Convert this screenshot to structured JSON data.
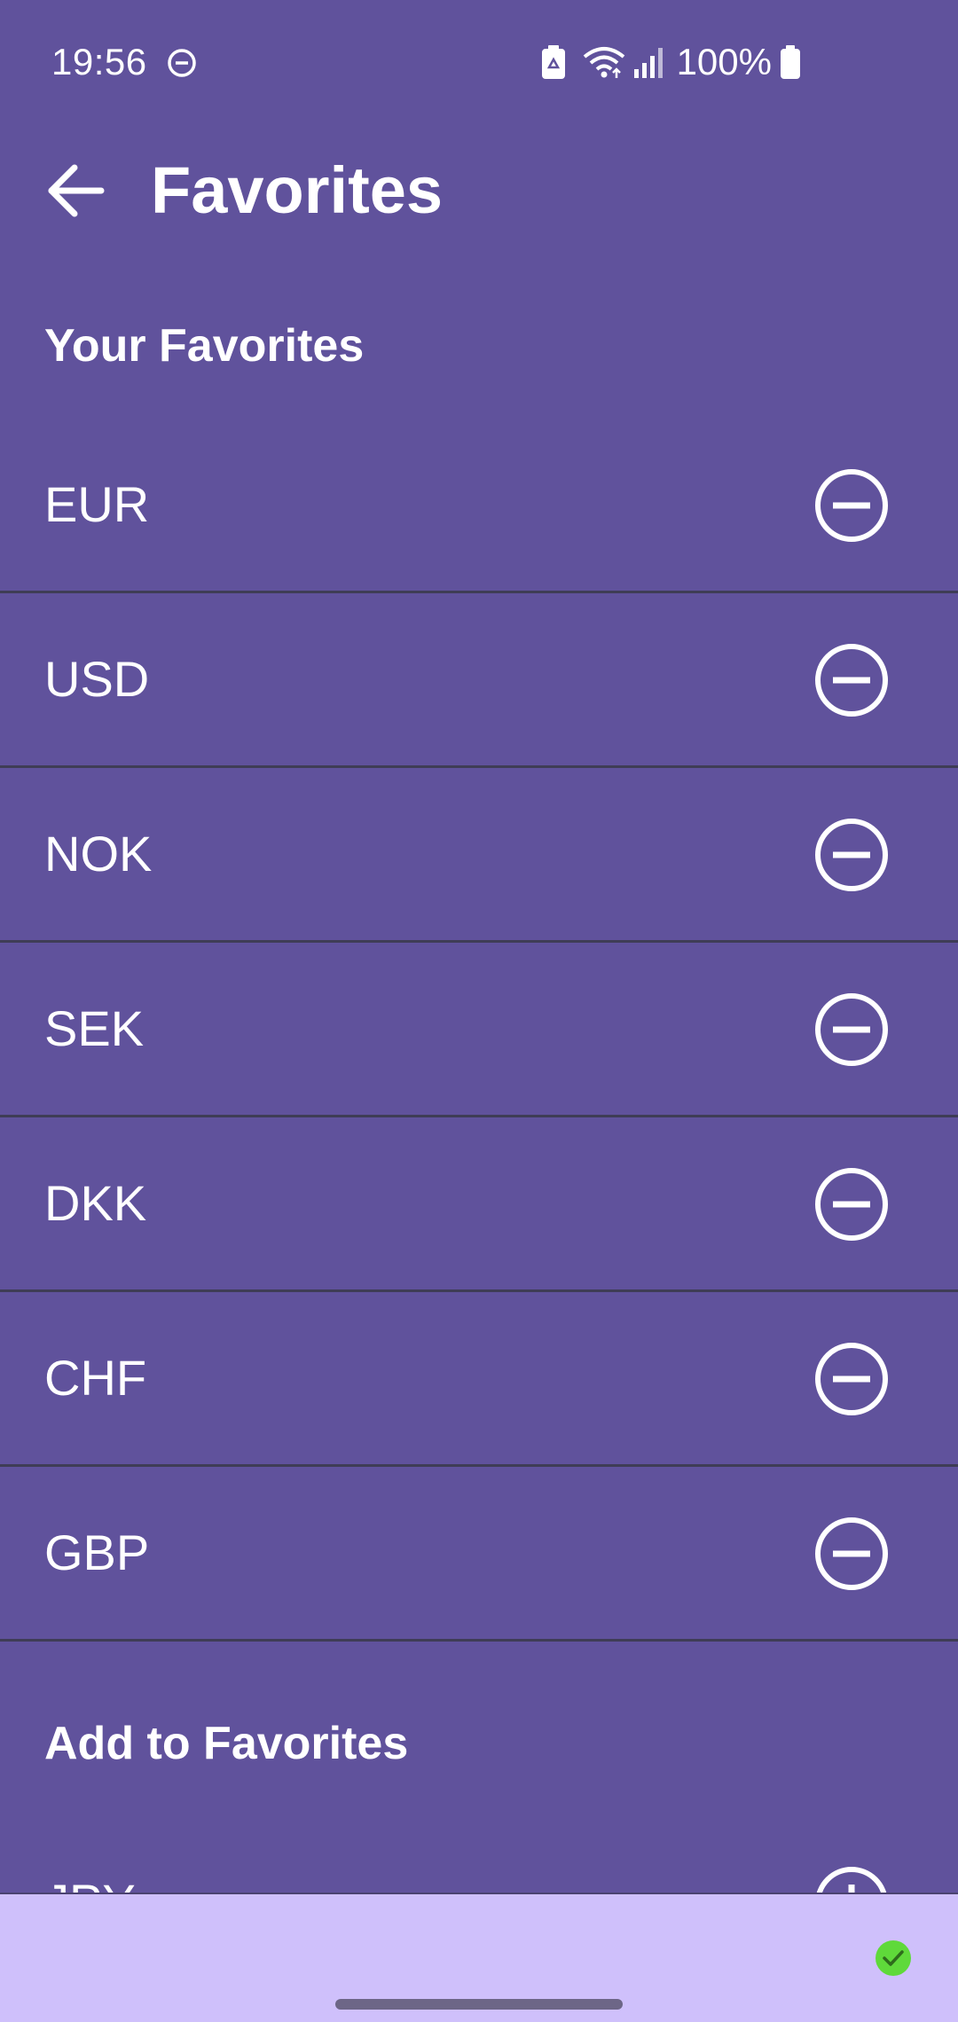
{
  "status_bar": {
    "time": "19:56",
    "battery": "100%",
    "icons": [
      "do-not-disturb-icon",
      "battery-saver-icon",
      "wifi-icon",
      "cellular-signal-icon",
      "battery-icon"
    ]
  },
  "app_bar": {
    "title": "Favorites",
    "back_icon": "arrow-left-icon"
  },
  "favorites": {
    "header": "Your Favorites",
    "items": [
      {
        "code": "EUR",
        "action_icon": "remove-circle-icon"
      },
      {
        "code": "USD",
        "action_icon": "remove-circle-icon"
      },
      {
        "code": "NOK",
        "action_icon": "remove-circle-icon"
      },
      {
        "code": "SEK",
        "action_icon": "remove-circle-icon"
      },
      {
        "code": "DKK",
        "action_icon": "remove-circle-icon"
      },
      {
        "code": "CHF",
        "action_icon": "remove-circle-icon"
      },
      {
        "code": "GBP",
        "action_icon": "remove-circle-icon"
      }
    ]
  },
  "add_favorites": {
    "header": "Add to Favorites",
    "items": [
      {
        "code": "JPY",
        "action_icon": "add-circle-icon"
      }
    ]
  },
  "bottom_bar": {
    "status_icon": "check-circle-icon"
  },
  "colors": {
    "background": "#60529c",
    "divider": "#3f3d56",
    "text": "#ffffff",
    "bottom_bar": "#cfc0fb",
    "success": "#5fd93a"
  }
}
